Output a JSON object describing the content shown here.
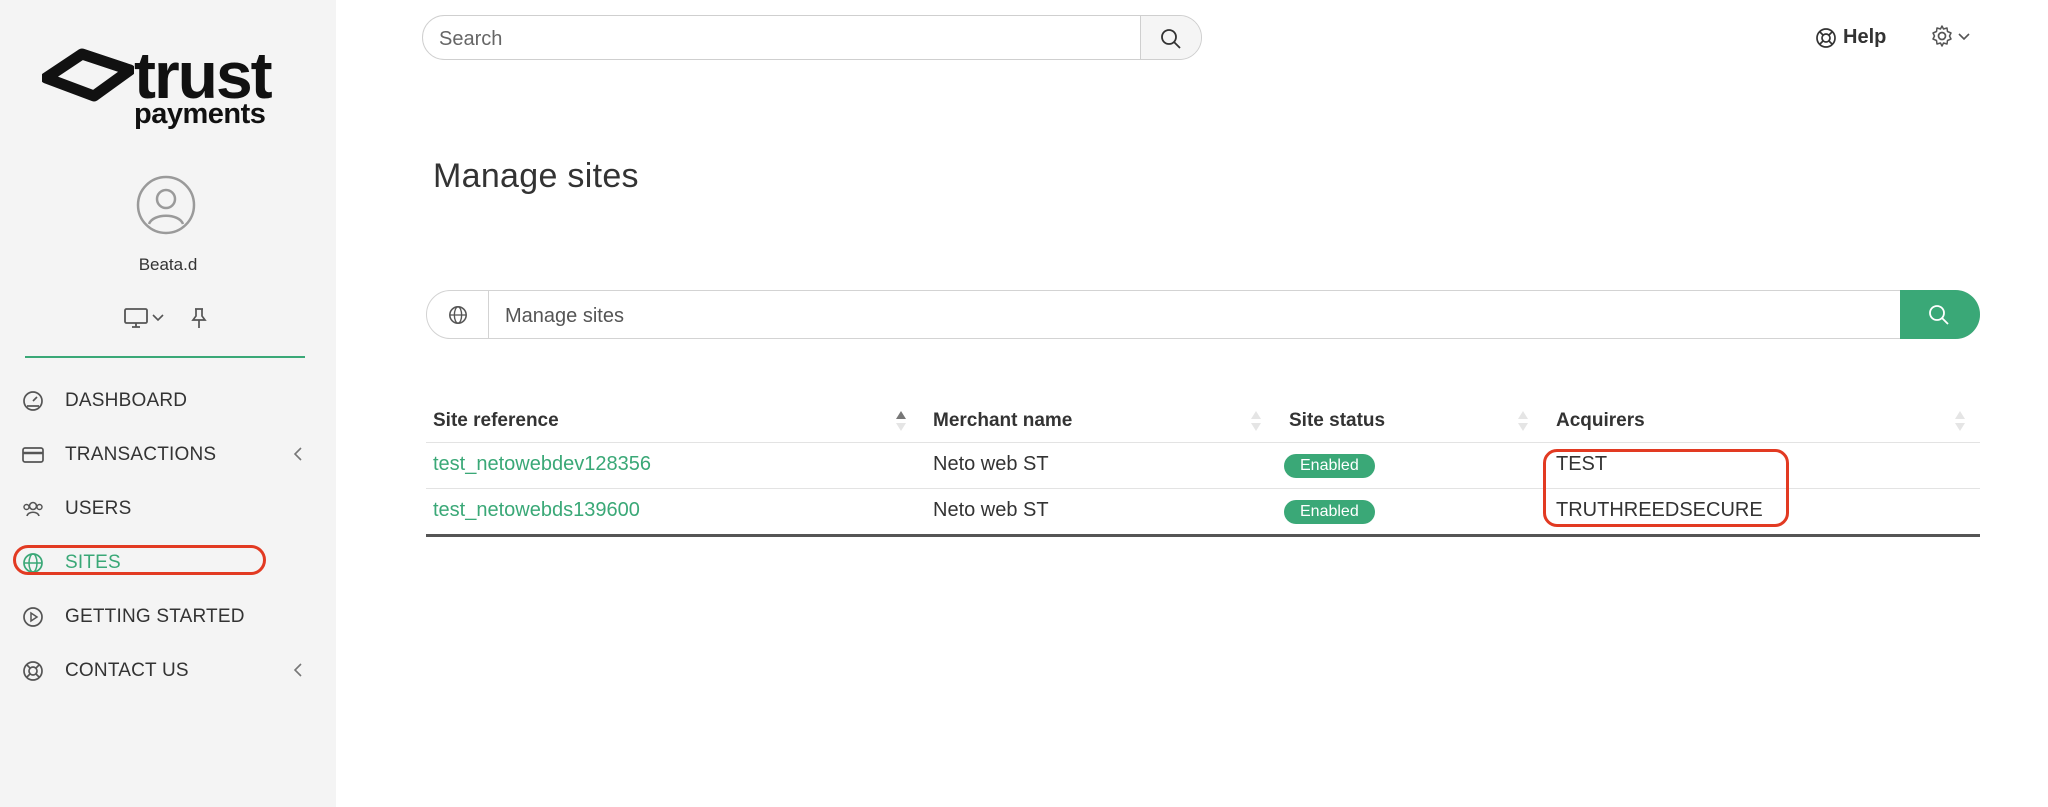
{
  "brand": {
    "name": "trust",
    "sub": "payments"
  },
  "user": {
    "name": "Beata.d"
  },
  "sidebar": {
    "items": [
      {
        "label": "DASHBOARD",
        "icon": "gauge-icon"
      },
      {
        "label": "TRANSACTIONS",
        "icon": "credit-card-icon"
      },
      {
        "label": "USERS",
        "icon": "users-icon"
      },
      {
        "label": "SITES",
        "icon": "globe-icon",
        "active": true
      },
      {
        "label": "GETTING STARTED",
        "icon": "play-circle-icon"
      },
      {
        "label": "CONTACT US",
        "icon": "lifebuoy-icon"
      }
    ]
  },
  "header": {
    "search_placeholder": "Search",
    "help_label": "Help"
  },
  "main": {
    "title": "Manage sites",
    "filter_placeholder": "Manage sites",
    "table": {
      "columns": [
        "Site reference",
        "Merchant name",
        "Site status",
        "Acquirers"
      ],
      "rows": [
        {
          "site_reference": "test_netowebdev128356",
          "merchant_name": "Neto web ST",
          "status": "Enabled",
          "acquirer": "TEST"
        },
        {
          "site_reference": "test_netowebds139600",
          "merchant_name": "Neto web ST",
          "status": "Enabled",
          "acquirer": "TRUTHREEDSECURE"
        }
      ]
    }
  },
  "colors": {
    "accent": "#3aa877",
    "highlight": "#e23a22",
    "sidebar_bg": "#f4f4f4"
  }
}
